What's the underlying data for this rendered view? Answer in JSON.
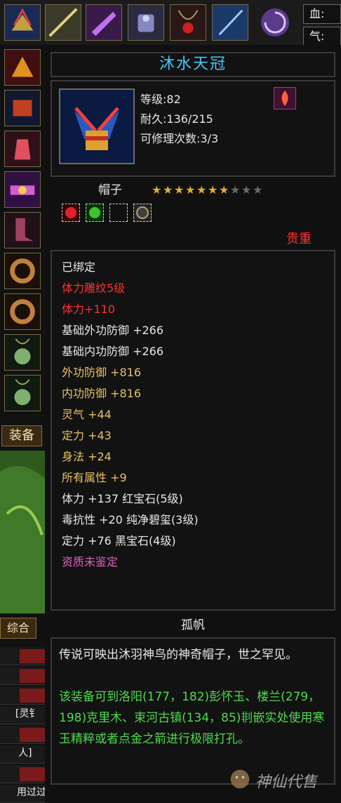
{
  "right_stats": {
    "hp_label": "血:",
    "qi_label": "气:"
  },
  "sidebar": {
    "equip_tab": "装备",
    "general_tab": "综合",
    "chat_fragments": [
      "[灵钅",
      "人]",
      "用过过发光"
    ]
  },
  "item": {
    "name": "沐水天冠",
    "level": "等级:82",
    "durability": "耐久:136/215",
    "repairs": "可修理次数:3/3",
    "type": "帽子",
    "stars_filled": 7,
    "stars_total": 10,
    "rarity": "贵重",
    "attributes": [
      {
        "text": "已绑定",
        "color": "white"
      },
      {
        "text": "体力雕纹5级",
        "color": "red"
      },
      {
        "text": "体力+110",
        "color": "red"
      },
      {
        "text": "基础外功防御 +266",
        "color": "white"
      },
      {
        "text": "基础内功防御 +266",
        "color": "white"
      },
      {
        "text": "外功防御 +816",
        "color": "gold"
      },
      {
        "text": "内功防御 +816",
        "color": "gold"
      },
      {
        "text": "灵气 +44",
        "color": "gold"
      },
      {
        "text": "定力 +43",
        "color": "gold"
      },
      {
        "text": "身法 +24",
        "color": "gold"
      },
      {
        "text": "所有属性 +9",
        "color": "gold"
      },
      {
        "text": "体力 +137 红宝石(5级)",
        "color": "white"
      },
      {
        "text": "毒抗性 +20 纯净碧玺(3级)",
        "color": "white"
      },
      {
        "text": "定力 +76 黑宝石(4级)",
        "color": "white"
      },
      {
        "text": "资质未鉴定",
        "color": "pink"
      }
    ],
    "maker": "孤帆",
    "description": "传说可映出沐羽神鸟的神奇帽子，世之罕见。",
    "hint": "该装备可到洛阳(177，182)彭怀玉、楼兰(279，198)克里木、束河古镇(134，85)剕嵌实处使用寒玉精粹或者点金之箭进行极限打孔。"
  },
  "watermark": "神仙代售",
  "colors": {
    "title": "#40c8ff",
    "gold": "#e8c060",
    "red": "#ff3030",
    "pink": "#e060c0",
    "green": "#4cdc4c"
  }
}
